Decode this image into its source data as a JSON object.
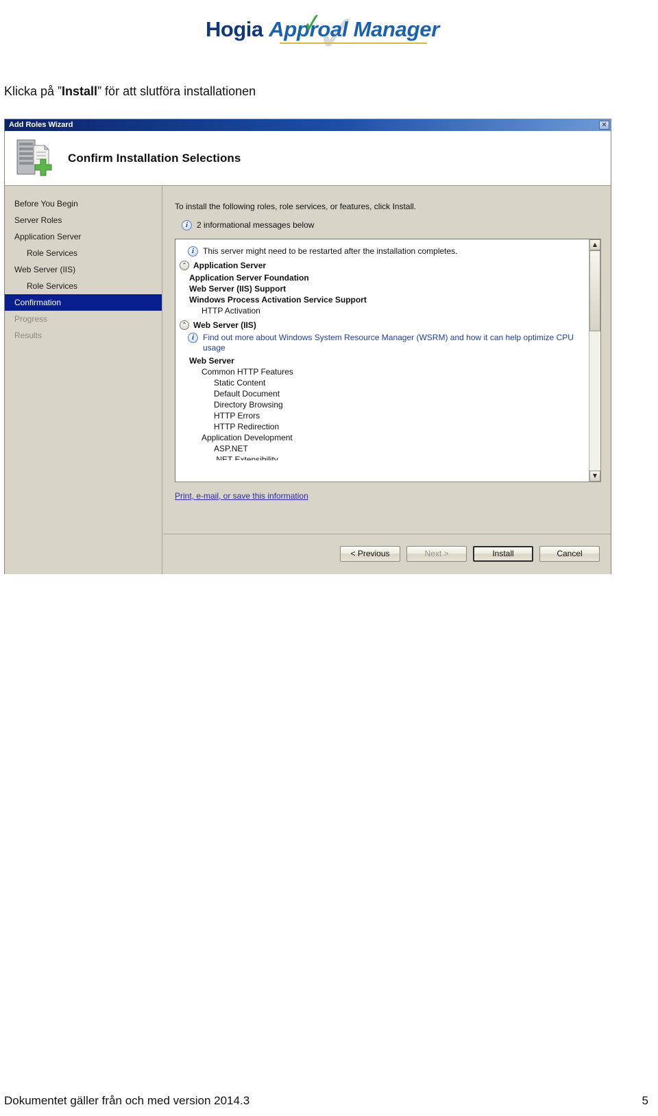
{
  "logo": {
    "word1": "Hogia",
    "word2a": "Appro",
    "word2b": "al Manager",
    "check_glyph": "✓",
    "watermark_glyph": "✓",
    "accent_blue": "#10387a",
    "accent_italic_blue": "#1a62b0",
    "accent_green": "#3aa93a",
    "accent_gold": "#d9b741"
  },
  "instruction": {
    "before": "Klicka på ”",
    "bold": "Install",
    "after": "” för att slutföra installationen"
  },
  "wizard": {
    "title": "Add Roles Wizard",
    "close_label": "✕",
    "banner_title": "Confirm Installation Selections",
    "sidebar": [
      {
        "label": "Before You Begin",
        "state": "normal",
        "indent": 0
      },
      {
        "label": "Server Roles",
        "state": "normal",
        "indent": 0
      },
      {
        "label": "Application Server",
        "state": "normal",
        "indent": 0
      },
      {
        "label": "Role Services",
        "state": "normal",
        "indent": 1
      },
      {
        "label": "Web Server (IIS)",
        "state": "normal",
        "indent": 0
      },
      {
        "label": "Role Services",
        "state": "normal",
        "indent": 1
      },
      {
        "label": "Confirmation",
        "state": "selected",
        "indent": 0
      },
      {
        "label": "Progress",
        "state": "disabled",
        "indent": 0
      },
      {
        "label": "Results",
        "state": "disabled",
        "indent": 0
      }
    ],
    "intro": "To install the following roles, role services, or features, click Install.",
    "info_count_icon": "i",
    "info_count": "2 informational messages below",
    "list": {
      "restart_note_icon": "i",
      "restart_note": "This server might need to be restarted after the installation completes.",
      "group1": {
        "collapse_icon": "⌃",
        "title": "Application Server",
        "items": [
          {
            "label": "Application Server Foundation",
            "bold": true,
            "indent": 1
          },
          {
            "label": "Web Server (IIS) Support",
            "bold": true,
            "indent": 1
          },
          {
            "label": "Windows Process Activation Service Support",
            "bold": true,
            "indent": 1
          },
          {
            "label": "HTTP Activation",
            "bold": false,
            "indent": 2
          }
        ]
      },
      "group2": {
        "collapse_icon": "⌃",
        "title": "Web Server (IIS)",
        "wsrm_icon": "i",
        "wsrm_note": "Find out more about Windows System Resource Manager (WSRM) and how it can help optimize CPU usage",
        "items": [
          {
            "label": "Web Server",
            "bold": true,
            "indent": 1
          },
          {
            "label": "Common HTTP Features",
            "bold": false,
            "indent": 2
          },
          {
            "label": "Static Content",
            "bold": false,
            "indent": 3
          },
          {
            "label": "Default Document",
            "bold": false,
            "indent": 3
          },
          {
            "label": "Directory Browsing",
            "bold": false,
            "indent": 3
          },
          {
            "label": "HTTP Errors",
            "bold": false,
            "indent": 3
          },
          {
            "label": "HTTP Redirection",
            "bold": false,
            "indent": 3
          },
          {
            "label": "Application Development",
            "bold": false,
            "indent": 2
          },
          {
            "label": "ASP.NET",
            "bold": false,
            "indent": 3
          },
          {
            "label": ".NET Extensibility",
            "bold": false,
            "indent": 3
          }
        ]
      }
    },
    "scrollbar": {
      "up_glyph": "▲",
      "down_glyph": "▼"
    },
    "print_link": "Print, e-mail, or save this information",
    "buttons": [
      {
        "label": "< Previous",
        "state": "normal"
      },
      {
        "label": "Next >",
        "state": "disabled"
      },
      {
        "label": "Install",
        "state": "default"
      },
      {
        "label": "Cancel",
        "state": "normal"
      }
    ]
  },
  "footer": {
    "text": "Dokumentet gäller från och med version 2014.3",
    "page": "5"
  }
}
